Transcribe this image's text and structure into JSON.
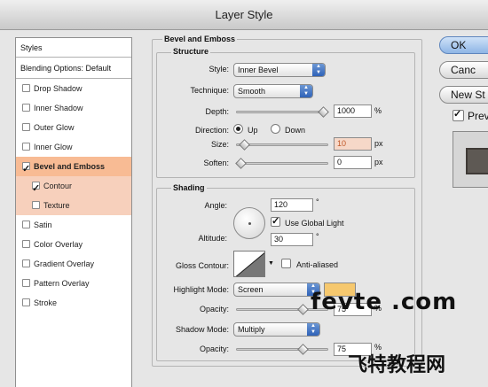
{
  "window": {
    "title": "Layer Style"
  },
  "sidebar": {
    "header": "Styles",
    "blending": "Blending Options: Default",
    "items": [
      {
        "label": "Drop Shadow",
        "checked": false,
        "selected": false,
        "sub": false
      },
      {
        "label": "Inner Shadow",
        "checked": false,
        "selected": false,
        "sub": false
      },
      {
        "label": "Outer Glow",
        "checked": false,
        "selected": false,
        "sub": false
      },
      {
        "label": "Inner Glow",
        "checked": false,
        "selected": false,
        "sub": false
      },
      {
        "label": "Bevel and Emboss",
        "checked": true,
        "selected": true,
        "sub": false
      },
      {
        "label": "Contour",
        "checked": true,
        "selected": false,
        "sub": true
      },
      {
        "label": "Texture",
        "checked": false,
        "selected": false,
        "sub": true
      },
      {
        "label": "Satin",
        "checked": false,
        "selected": false,
        "sub": false
      },
      {
        "label": "Color Overlay",
        "checked": false,
        "selected": false,
        "sub": false
      },
      {
        "label": "Gradient Overlay",
        "checked": false,
        "selected": false,
        "sub": false
      },
      {
        "label": "Pattern Overlay",
        "checked": false,
        "selected": false,
        "sub": false
      },
      {
        "label": "Stroke",
        "checked": false,
        "selected": false,
        "sub": false
      }
    ]
  },
  "panel": {
    "title": "Bevel and Emboss",
    "structure": {
      "title": "Structure",
      "style_label": "Style:",
      "style_value": "Inner Bevel",
      "technique_label": "Technique:",
      "technique_value": "Smooth",
      "depth_label": "Depth:",
      "depth_value": "1000",
      "depth_unit": "%",
      "depth_level": 1.0,
      "direction_label": "Direction:",
      "direction_up": "Up",
      "direction_down": "Down",
      "size_label": "Size:",
      "size_value": "10",
      "size_unit": "px",
      "size_level": 0.04,
      "soften_label": "Soften:",
      "soften_value": "0",
      "soften_unit": "px",
      "soften_level": 0.0
    },
    "shading": {
      "title": "Shading",
      "angle_label": "Angle:",
      "angle_value": "120",
      "angle_unit": "°",
      "global_light_label": "Use Global Light",
      "altitude_label": "Altitude:",
      "altitude_value": "30",
      "altitude_unit": "°",
      "gloss_label": "Gloss Contour:",
      "antialiased_label": "Anti-aliased",
      "highlight_mode_label": "Highlight Mode:",
      "highlight_mode_value": "Screen",
      "highlight_color": "#f6c86e",
      "highlight_opacity_label": "Opacity:",
      "highlight_opacity_value": "75",
      "highlight_opacity_unit": "%",
      "highlight_opacity_level": 0.75,
      "shadow_mode_label": "Shadow Mode:",
      "shadow_mode_value": "Multiply",
      "shadow_opacity_label": "Opacity:",
      "shadow_opacity_value": "75",
      "shadow_opacity_unit": "%",
      "shadow_opacity_level": 0.75
    }
  },
  "buttons": {
    "ok": "OK",
    "cancel": "Canc",
    "new_style": "New St",
    "preview": "Prev"
  },
  "watermark": {
    "site": "fevte .com",
    "cn": "飞特教程网"
  }
}
